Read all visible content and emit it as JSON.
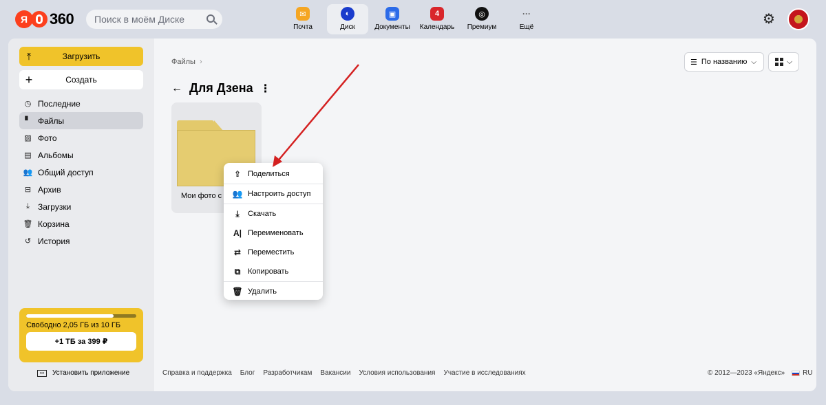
{
  "header": {
    "logo_ya": "Я",
    "logo_360": "360",
    "search_placeholder": "Поиск в моём Диске",
    "apps": [
      {
        "label": "Почта",
        "color": "#f5a623"
      },
      {
        "label": "Диск",
        "color": "#1a3ccc"
      },
      {
        "label": "Документы",
        "color": "#2c6be8"
      },
      {
        "label": "Календарь",
        "color": "#d9262b",
        "badge": "4"
      },
      {
        "label": "Премиум",
        "color": "#111111"
      },
      {
        "label": "Ещё",
        "color": "#888888"
      }
    ]
  },
  "sidebar": {
    "upload_label": "Загрузить",
    "create_label": "Создать",
    "items": [
      {
        "label": "Последние",
        "icon": "clock-icon"
      },
      {
        "label": "Файлы",
        "icon": "file-icon"
      },
      {
        "label": "Фото",
        "icon": "photo-icon"
      },
      {
        "label": "Альбомы",
        "icon": "album-icon"
      },
      {
        "label": "Общий доступ",
        "icon": "people-icon"
      },
      {
        "label": "Архив",
        "icon": "archive-icon"
      },
      {
        "label": "Загрузки",
        "icon": "download-icon"
      },
      {
        "label": "Корзина",
        "icon": "trash-icon"
      },
      {
        "label": "История",
        "icon": "history-icon"
      }
    ],
    "quota_text": "Свободно 2,05 ГБ из 10 ГБ",
    "quota_used_fraction": 0.795,
    "quota_button": "+1 ТБ за 399 ₽",
    "install_label": "Установить приложение"
  },
  "content": {
    "breadcrumb": "Файлы",
    "breadcrumb_sep": "›",
    "title": "Для Дзена",
    "sort_label": "По названию",
    "folder_name": "Мои фото с те"
  },
  "context_menu": {
    "items": [
      {
        "label": "Поделиться",
        "icon": "share-icon"
      },
      {
        "label": "Настроить доступ",
        "icon": "people-icon"
      },
      {
        "label": "Скачать",
        "icon": "download-icon"
      },
      {
        "label": "Переименовать",
        "icon": "rename-icon"
      },
      {
        "label": "Переместить",
        "icon": "move-icon"
      },
      {
        "label": "Копировать",
        "icon": "copy-icon"
      },
      {
        "label": "Удалить",
        "icon": "trash-icon"
      }
    ]
  },
  "footer": {
    "links": [
      "Справка и поддержка",
      "Блог",
      "Разработчикам",
      "Вакансии",
      "Условия использования",
      "Участие в исследованиях"
    ],
    "copyright": "© 2012—2023 «Яндекс»",
    "lang": "RU"
  },
  "colors": {
    "accent_yellow": "#f0c32a",
    "arrow_red": "#d42020"
  }
}
